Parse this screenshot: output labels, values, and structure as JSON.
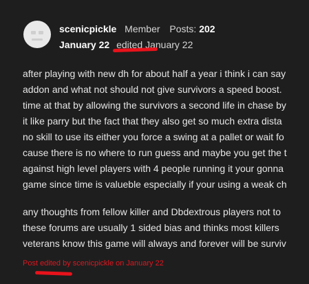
{
  "post": {
    "author": {
      "username": "scenicpickle",
      "role": "Member",
      "posts_label": "Posts:",
      "posts_count": "202",
      "avatar_icon": "default-avatar-icon"
    },
    "date": "January 22",
    "edited_text": "edited January 22",
    "body": {
      "paragraph1": [
        "after playing with new dh for about half a year i think i can say",
        "addon and what not should not give survivors a speed boost.",
        "time at that by allowing the survivors a second life in chase by",
        "it like parry but the fact that they also get so much extra dista",
        "no skill to use its either you force a swing at a pallet or wait fo",
        "cause there is no where to run guess and maybe you get the t",
        "against high level players with 4 people running it your gonna",
        "game since time is valueble especially if your using a weak ch"
      ],
      "paragraph2": [
        "any thoughts from fellow killer and Dbdextrous players not to",
        "these forums are usually 1 sided bias and thinks most killers",
        "veterans know this game will always and forever will be surviv"
      ]
    },
    "edit_note": "Post edited by scenicpickle on January 22"
  },
  "colors": {
    "background": "#1e1e1e",
    "text": "#e6e6e6",
    "edit_note": "#e0161f",
    "annotation_red": "#e8121b"
  }
}
